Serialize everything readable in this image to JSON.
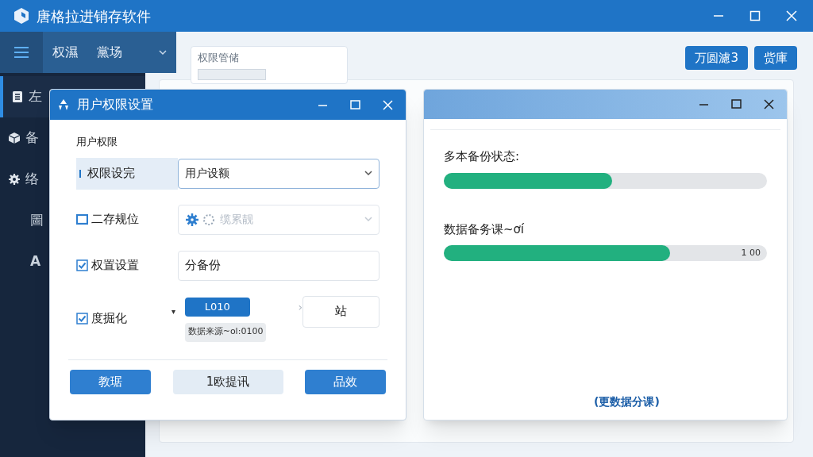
{
  "window": {
    "title": "唐格拉进销存软件"
  },
  "nav": {
    "items": [
      "权濕",
      "黨场"
    ]
  },
  "sidebar": {
    "items": [
      {
        "label": "左",
        "selected": true
      },
      {
        "label": "备",
        "selected": false
      },
      {
        "label": "络",
        "selected": false
      },
      {
        "label": "圖",
        "selected": false
      },
      {
        "label": "A",
        "selected": false
      }
    ]
  },
  "main": {
    "card_title": "权限管储",
    "buttons": [
      "万圆濾3",
      "赀庫"
    ],
    "link": "(更数据分课)"
  },
  "permission_dialog": {
    "title": "用户权限设置",
    "section": "用户权限",
    "rows": [
      {
        "kind": "select",
        "label": "权限设完",
        "value": "用户设额",
        "selected": true
      },
      {
        "kind": "check-select",
        "label": "二存规位",
        "checked": false,
        "value": "缆累靓",
        "disabled": true
      },
      {
        "kind": "check-input",
        "label": "权置设置",
        "checked": true,
        "value": "分备份"
      },
      {
        "kind": "check-chip",
        "label": "度掘化",
        "checked": true,
        "caret": "▾",
        "chip": "L010",
        "tag": "数据来源~ol:0100",
        "arrow": "›",
        "box": "站"
      }
    ],
    "buttons": [
      {
        "label": "教琚",
        "primary": true
      },
      {
        "label": "1欧提讯",
        "primary": false
      },
      {
        "label": "品效",
        "primary": true
      }
    ]
  },
  "backup_dialog": {
    "progress": [
      {
        "label": "多本备份状态:",
        "level": 0.52
      },
      {
        "label": "数据备务课~ơí",
        "level": 0.7,
        "reading": "1 00"
      }
    ]
  }
}
